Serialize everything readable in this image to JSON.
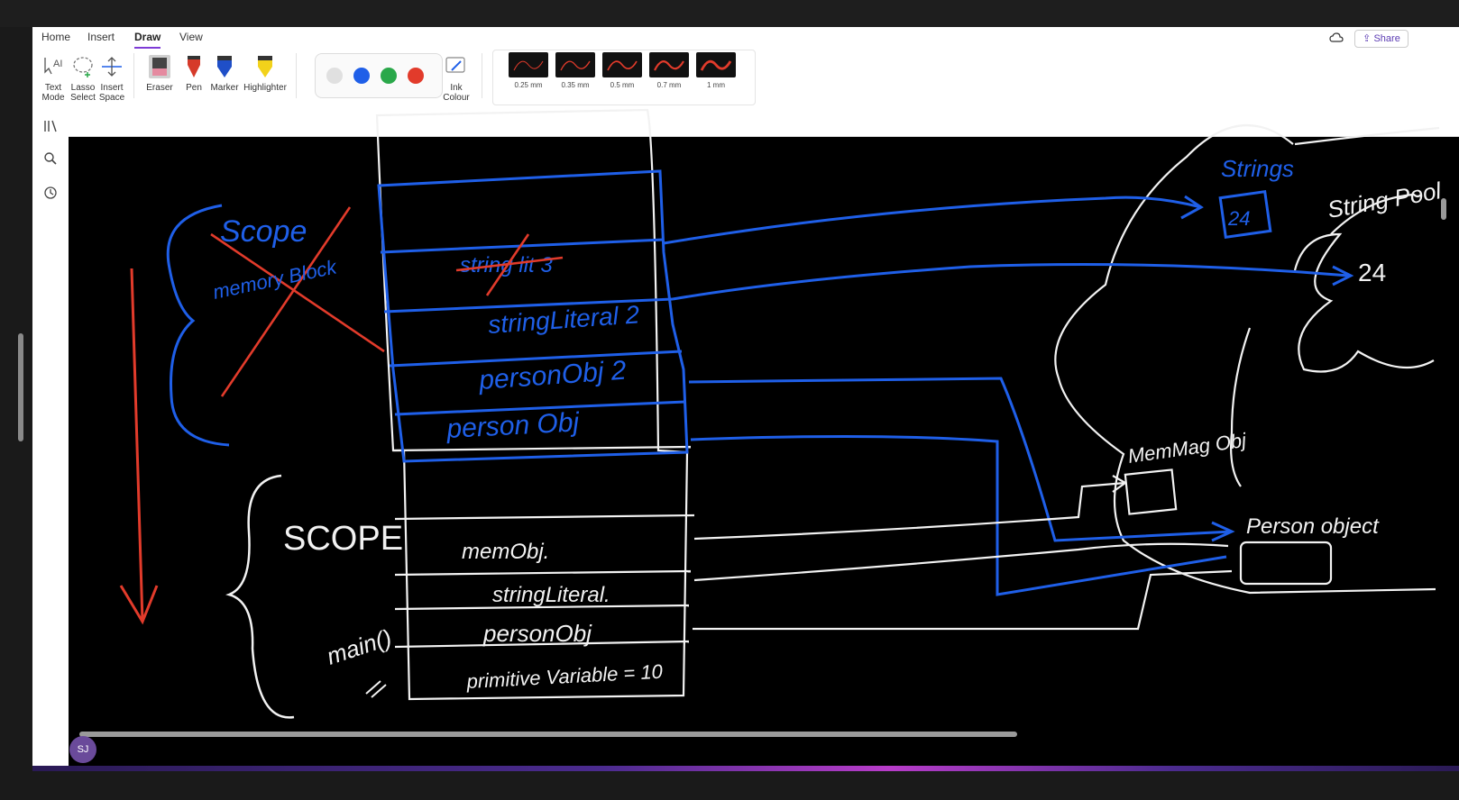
{
  "tabs": [
    "Home",
    "Insert",
    "Draw",
    "View"
  ],
  "active_tab": "Draw",
  "share_label": "Share",
  "tools": {
    "text_mode": "Text\nMode",
    "lasso": "Lasso\nSelect",
    "insert_space": "Insert\nSpace",
    "eraser": "Eraser",
    "pen": "Pen",
    "marker": "Marker",
    "highlighter": "Highlighter",
    "ink_colour": "Ink\nColour"
  },
  "ink_colors": [
    "#e0e0e0",
    "#1f5fe8",
    "#2aa84a",
    "#e23b2b"
  ],
  "thicknesses": [
    "0.25 mm",
    "0.35 mm",
    "0.5 mm",
    "0.7 mm",
    "1 mm"
  ],
  "avatar": "SJ",
  "canvas_text": {
    "scope_top": "Scope",
    "memory_block": "memory Block",
    "string_lit_3": "string lit 3",
    "string_literal_2": "stringLiteral 2",
    "person_obj_2": "personObj 2",
    "person_obj": "person Obj",
    "scope_bottom": "SCOPE",
    "mem_obj": "memObj.",
    "string_literal": "stringLiteral.",
    "person_obj_bottom": "personObj",
    "primitive": "primitive Variable = 10",
    "main": "main()",
    "string_label": "Strings",
    "pool_value_24": "24",
    "string_pool": "String Pool",
    "pool_24": "24",
    "mem_mag_obj": "MemMag Obj",
    "person_object": "Person object"
  }
}
